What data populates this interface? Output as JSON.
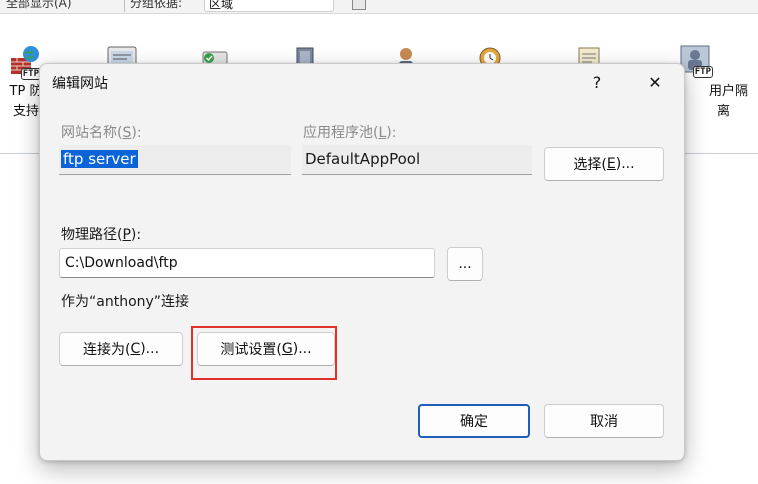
{
  "background": {
    "toolbar": {
      "item_a": "全部显示(A)",
      "item_b": "分组依据:",
      "group_value": "区域"
    },
    "features": [
      {
        "icon": "ftp-firewall-icon",
        "label_line1": "TP 防",
        "label_line2": "支持"
      },
      {
        "icon": "ftp-ip-restrictions-icon",
        "label_line1": "",
        "label_line2": ""
      },
      {
        "icon": "ftp-authentication-icon",
        "label_line1": "",
        "label_line2": ""
      },
      {
        "icon": "ftp-directory-browsing-icon",
        "label_line1": "",
        "label_line2": ""
      },
      {
        "icon": "ftp-authorization-icon",
        "label_line1": "",
        "label_line2": ""
      },
      {
        "icon": "ftp-logging-icon",
        "label_line1": "",
        "label_line2": ""
      },
      {
        "icon": "ftp-messages-icon",
        "label_line1": "",
        "label_line2": ""
      },
      {
        "icon": "ftp-user-isolation-icon",
        "label_line1": "用户隔",
        "label_line2": "离"
      }
    ]
  },
  "dialog": {
    "title": "编辑网站",
    "help_glyph": "?",
    "close_glyph": "✕",
    "site_name": {
      "label": "网站名称(",
      "accel": "S",
      "label_end": "):",
      "value": "ftp server"
    },
    "app_pool": {
      "label": "应用程序池(",
      "accel": "L",
      "label_end": "):",
      "value": "DefaultAppPool"
    },
    "select_button": {
      "label": "选择(",
      "accel": "E",
      "label_end": ")..."
    },
    "physical_path": {
      "label": "物理路径(",
      "accel": "P",
      "label_end": "):",
      "value": "C:\\Download\\ftp"
    },
    "browse_button": {
      "label": "..."
    },
    "connect_as_text": "作为“anthony”连接",
    "connect_as_button": {
      "label": "连接为(",
      "accel": "C",
      "label_end": ")..."
    },
    "test_settings_button": {
      "label": "测试设置(",
      "accel": "G",
      "label_end": ")..."
    },
    "ok_button": {
      "label": "确定"
    },
    "cancel_button": {
      "label": "取消"
    }
  },
  "colors": {
    "selection": "#0a64d8",
    "highlight_box": "#e0302a",
    "primary_border": "#1f5fb8"
  }
}
